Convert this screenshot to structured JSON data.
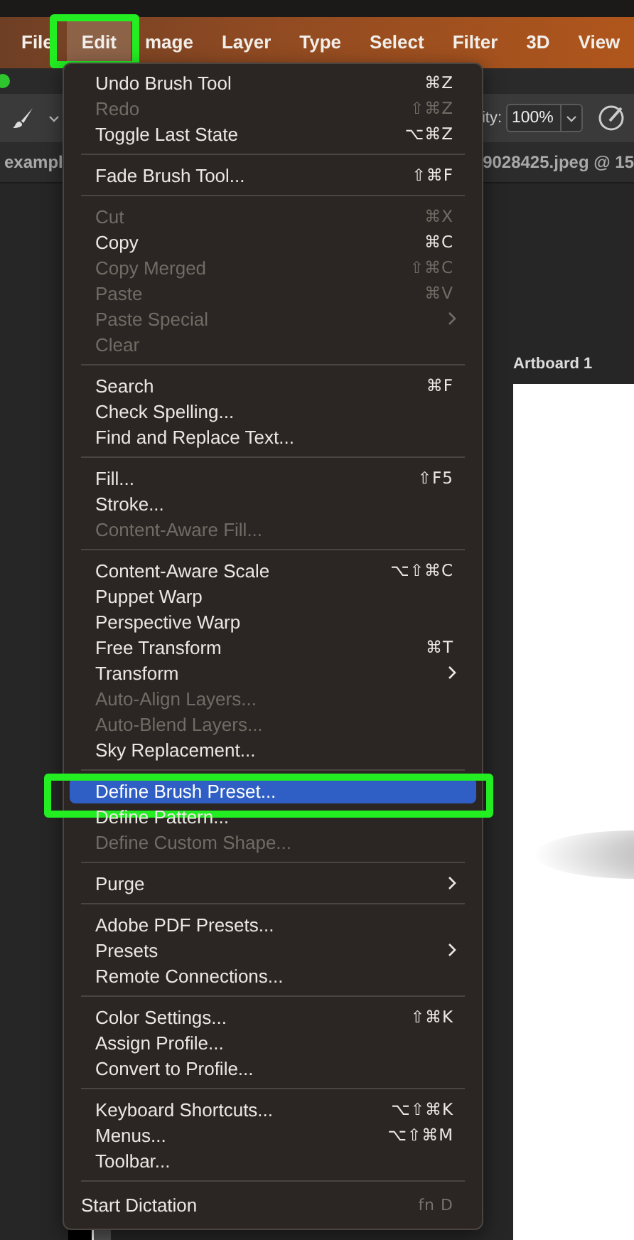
{
  "menubar": {
    "items": [
      {
        "label": "File",
        "selected": false,
        "outlined": false
      },
      {
        "label": "Edit",
        "selected": true,
        "outlined": true
      },
      {
        "label": "mage",
        "selected": false,
        "outlined": false
      },
      {
        "label": "Layer",
        "selected": false,
        "outlined": false
      },
      {
        "label": "Type",
        "selected": false,
        "outlined": false
      },
      {
        "label": "Select",
        "selected": false,
        "outlined": false
      },
      {
        "label": "Filter",
        "selected": false,
        "outlined": false
      },
      {
        "label": "3D",
        "selected": false,
        "outlined": false
      },
      {
        "label": "View",
        "selected": false,
        "outlined": false
      }
    ]
  },
  "options_bar": {
    "opacity_label": "ity:",
    "opacity_value": "100%"
  },
  "document_tabs": [
    {
      "label": "exampl"
    },
    {
      "label": "9028425.jpeg @ 15"
    }
  ],
  "canvas": {
    "artboard_label": "Artboard 1"
  },
  "edit_menu": {
    "items": [
      {
        "kind": "item",
        "label": "Undo Brush Tool",
        "shortcut": "⌘Z",
        "disabled": false,
        "submenu": false,
        "selected": false,
        "outlined": false
      },
      {
        "kind": "item",
        "label": "Redo",
        "shortcut": "⇧⌘Z",
        "disabled": true,
        "submenu": false,
        "selected": false,
        "outlined": false
      },
      {
        "kind": "item",
        "label": "Toggle Last State",
        "shortcut": "⌥⌘Z",
        "disabled": false,
        "submenu": false,
        "selected": false,
        "outlined": false
      },
      {
        "kind": "separator"
      },
      {
        "kind": "item",
        "label": "Fade Brush Tool...",
        "shortcut": "⇧⌘F",
        "disabled": false,
        "submenu": false,
        "selected": false,
        "outlined": false
      },
      {
        "kind": "separator"
      },
      {
        "kind": "item",
        "label": "Cut",
        "shortcut": "⌘X",
        "disabled": true,
        "submenu": false,
        "selected": false,
        "outlined": false
      },
      {
        "kind": "item",
        "label": "Copy",
        "shortcut": "⌘C",
        "disabled": false,
        "submenu": false,
        "selected": false,
        "outlined": false
      },
      {
        "kind": "item",
        "label": "Copy Merged",
        "shortcut": "⇧⌘C",
        "disabled": true,
        "submenu": false,
        "selected": false,
        "outlined": false
      },
      {
        "kind": "item",
        "label": "Paste",
        "shortcut": "⌘V",
        "disabled": true,
        "submenu": false,
        "selected": false,
        "outlined": false
      },
      {
        "kind": "item",
        "label": "Paste Special",
        "disabled": true,
        "submenu": true,
        "selected": false,
        "outlined": false
      },
      {
        "kind": "item",
        "label": "Clear",
        "disabled": true,
        "submenu": false,
        "selected": false,
        "outlined": false
      },
      {
        "kind": "separator"
      },
      {
        "kind": "item",
        "label": "Search",
        "shortcut": "⌘F",
        "disabled": false,
        "submenu": false,
        "selected": false,
        "outlined": false
      },
      {
        "kind": "item",
        "label": "Check Spelling...",
        "disabled": false,
        "submenu": false,
        "selected": false,
        "outlined": false
      },
      {
        "kind": "item",
        "label": "Find and Replace Text...",
        "disabled": false,
        "submenu": false,
        "selected": false,
        "outlined": false
      },
      {
        "kind": "separator"
      },
      {
        "kind": "item",
        "label": "Fill...",
        "shortcut": "⇧F5",
        "disabled": false,
        "submenu": false,
        "selected": false,
        "outlined": false
      },
      {
        "kind": "item",
        "label": "Stroke...",
        "disabled": false,
        "submenu": false,
        "selected": false,
        "outlined": false
      },
      {
        "kind": "item",
        "label": "Content-Aware Fill...",
        "disabled": true,
        "submenu": false,
        "selected": false,
        "outlined": false
      },
      {
        "kind": "separator"
      },
      {
        "kind": "item",
        "label": "Content-Aware Scale",
        "shortcut": "⌥⇧⌘C",
        "disabled": false,
        "submenu": false,
        "selected": false,
        "outlined": false
      },
      {
        "kind": "item",
        "label": "Puppet Warp",
        "disabled": false,
        "submenu": false,
        "selected": false,
        "outlined": false
      },
      {
        "kind": "item",
        "label": "Perspective Warp",
        "disabled": false,
        "submenu": false,
        "selected": false,
        "outlined": false
      },
      {
        "kind": "item",
        "label": "Free Transform",
        "shortcut": "⌘T",
        "disabled": false,
        "submenu": false,
        "selected": false,
        "outlined": false
      },
      {
        "kind": "item",
        "label": "Transform",
        "disabled": false,
        "submenu": true,
        "selected": false,
        "outlined": false
      },
      {
        "kind": "item",
        "label": "Auto-Align Layers...",
        "disabled": true,
        "submenu": false,
        "selected": false,
        "outlined": false
      },
      {
        "kind": "item",
        "label": "Auto-Blend Layers...",
        "disabled": true,
        "submenu": false,
        "selected": false,
        "outlined": false
      },
      {
        "kind": "item",
        "label": "Sky Replacement...",
        "disabled": false,
        "submenu": false,
        "selected": false,
        "outlined": false
      },
      {
        "kind": "separator"
      },
      {
        "kind": "item",
        "label": "Define Brush Preset...",
        "disabled": false,
        "submenu": false,
        "selected": true,
        "outlined": true
      },
      {
        "kind": "item",
        "label": "Define Pattern...",
        "disabled": false,
        "submenu": false,
        "selected": false,
        "outlined": false
      },
      {
        "kind": "item",
        "label": "Define Custom Shape...",
        "disabled": true,
        "submenu": false,
        "selected": false,
        "outlined": false
      },
      {
        "kind": "separator"
      },
      {
        "kind": "item",
        "label": "Purge",
        "disabled": false,
        "submenu": true,
        "selected": false,
        "outlined": false
      },
      {
        "kind": "separator"
      },
      {
        "kind": "item",
        "label": "Adobe PDF Presets...",
        "disabled": false,
        "submenu": false,
        "selected": false,
        "outlined": false
      },
      {
        "kind": "item",
        "label": "Presets",
        "disabled": false,
        "submenu": true,
        "selected": false,
        "outlined": false
      },
      {
        "kind": "item",
        "label": "Remote Connections...",
        "disabled": false,
        "submenu": false,
        "selected": false,
        "outlined": false
      },
      {
        "kind": "separator"
      },
      {
        "kind": "item",
        "label": "Color Settings...",
        "shortcut": "⇧⌘K",
        "disabled": false,
        "submenu": false,
        "selected": false,
        "outlined": false
      },
      {
        "kind": "item",
        "label": "Assign Profile...",
        "disabled": false,
        "submenu": false,
        "selected": false,
        "outlined": false
      },
      {
        "kind": "item",
        "label": "Convert to Profile...",
        "disabled": false,
        "submenu": false,
        "selected": false,
        "outlined": false
      },
      {
        "kind": "separator"
      },
      {
        "kind": "item",
        "label": "Keyboard Shortcuts...",
        "shortcut": "⌥⇧⌘K",
        "disabled": false,
        "submenu": false,
        "selected": false,
        "outlined": false
      },
      {
        "kind": "item",
        "label": "Menus...",
        "shortcut": "⌥⇧⌘M",
        "disabled": false,
        "submenu": false,
        "selected": false,
        "outlined": false
      },
      {
        "kind": "item",
        "label": "Toolbar...",
        "disabled": false,
        "submenu": false,
        "selected": false,
        "outlined": false
      },
      {
        "kind": "separator"
      },
      {
        "kind": "footer",
        "label": "Start Dictation",
        "shortcut": "fn D",
        "disabled": false,
        "submenu": false,
        "selected": false,
        "outlined": false
      }
    ]
  }
}
